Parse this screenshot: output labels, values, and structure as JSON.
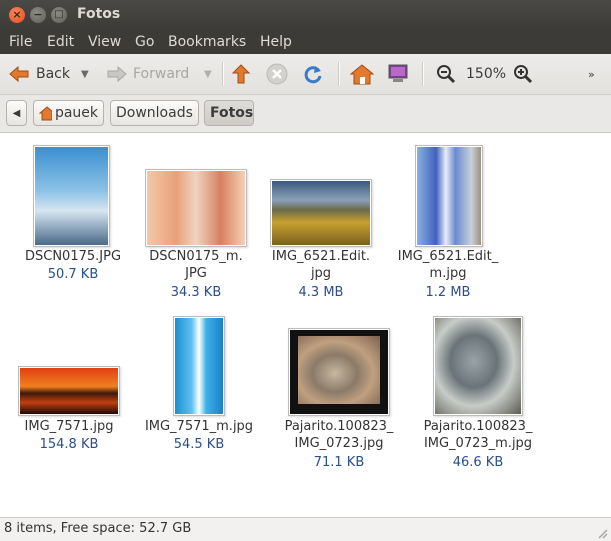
{
  "window": {
    "title": "Fotos"
  },
  "menu": [
    "File",
    "Edit",
    "View",
    "Go",
    "Bookmarks",
    "Help"
  ],
  "toolbar": {
    "back": "Back",
    "forward": "Forward",
    "zoom": "150%"
  },
  "path": [
    "pauek",
    "Downloads",
    "Fotos"
  ],
  "files": [
    {
      "name1": "DSCN0175.JPG",
      "name2": "",
      "size": "50.7 KB"
    },
    {
      "name1": "DSCN0175_m.",
      "name2": "JPG",
      "size": "34.3 KB"
    },
    {
      "name1": "IMG_6521.Edit.",
      "name2": "jpg",
      "size": "4.3 MB"
    },
    {
      "name1": "IMG_6521.Edit_",
      "name2": "m.jpg",
      "size": "1.2 MB"
    },
    {
      "name1": "IMG_7571.jpg",
      "name2": "",
      "size": "154.8 KB"
    },
    {
      "name1": "IMG_7571_m.jpg",
      "name2": "",
      "size": "54.5 KB"
    },
    {
      "name1": "Pajarito.100823_",
      "name2": "IMG_0723.jpg",
      "size": "71.1 KB"
    },
    {
      "name1": "Pajarito.100823_",
      "name2": "IMG_0723_m.jpg",
      "size": "46.6 KB"
    }
  ],
  "status": "8 items, Free space: 52.7 GB"
}
